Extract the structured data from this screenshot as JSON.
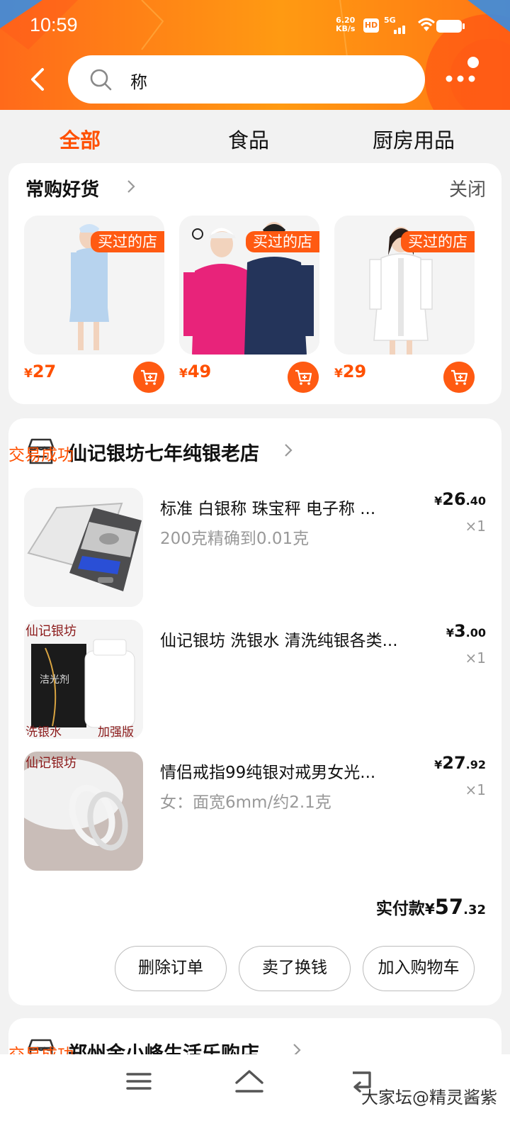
{
  "status_bar": {
    "time": "10:59",
    "net_speed": "6.20",
    "net_unit": "KB/s",
    "hd": "HD",
    "signal": "5G"
  },
  "header": {
    "search_query": "称"
  },
  "tabs": [
    {
      "label": "全部",
      "active": true
    },
    {
      "label": "食品",
      "active": false
    },
    {
      "label": "厨房用品",
      "active": false
    }
  ],
  "frequent": {
    "title": "常购好货",
    "close_label": "关闭",
    "items": [
      {
        "badge": "买过的店",
        "currency": "¥",
        "price": "27",
        "image": "light-blue-nurse-uniform"
      },
      {
        "badge": "买过的店",
        "currency": "¥",
        "price": "49",
        "image": "couple-fleece-jackets"
      },
      {
        "badge": "买过的店",
        "currency": "¥",
        "price": "29",
        "image": "white-lab-coat"
      }
    ]
  },
  "order": {
    "store": "仙记银坊七年纯银老店",
    "status": "交易成功",
    "products": [
      {
        "name": "标准 白银称 珠宝秤 电子称 ...",
        "spec": "200克精确到0.01克",
        "price_int": "26",
        "price_dec": ".40",
        "qty": "×1"
      },
      {
        "name": "仙记银坊 洗银水 清洗纯银各类...",
        "spec": "",
        "price_int": "3",
        "price_dec": ".00",
        "qty": "×1",
        "thumb_text": {
          "top": "仙记银坊",
          "bottle": "洁光剂",
          "left": "洗银水",
          "right": "加强版"
        }
      },
      {
        "name": "情侣戒指99纯银对戒男女光...",
        "spec": "女：面宽6mm/约2.1克",
        "price_int": "27",
        "price_dec": ".92",
        "qty": "×1",
        "thumb_text": {
          "top": "仙记银坊"
        }
      }
    ],
    "paid_label": "实付款",
    "paid_currency": "¥",
    "paid_int": "57",
    "paid_dec": ".32",
    "actions": [
      "删除订单",
      "卖了换钱",
      "加入购物车"
    ]
  },
  "next_order": {
    "store": "郑州金小峰生活乐购店",
    "status": "交易成功"
  },
  "watermark": "大家坛@精灵酱紫",
  "colors": {
    "accent": "#ff5000",
    "header_start": "#ff6a1a",
    "header_mid": "#ff9a12"
  }
}
